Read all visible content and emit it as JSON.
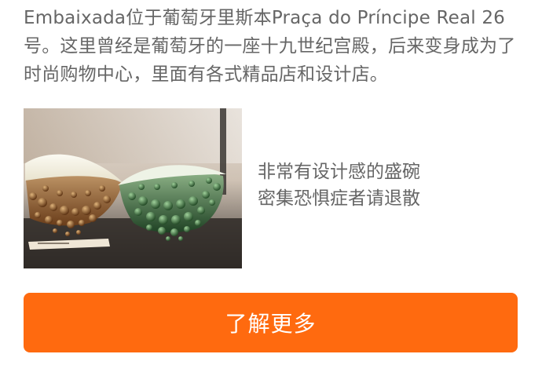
{
  "article": {
    "intro": "Embaixada位于葡萄牙里斯本Praça do Príncipe Real 26号。这里曾经是葡萄牙的一座十九世纪宫殿，后来变身成为了时尚购物中心，里面有各式精品店和设计店。"
  },
  "feature": {
    "caption_line_1": "非常有设计感的盛碗",
    "caption_line_2": "密集恐惧症者请退散"
  },
  "cta": {
    "label": "了解更多",
    "color": "#ff6a0f"
  }
}
